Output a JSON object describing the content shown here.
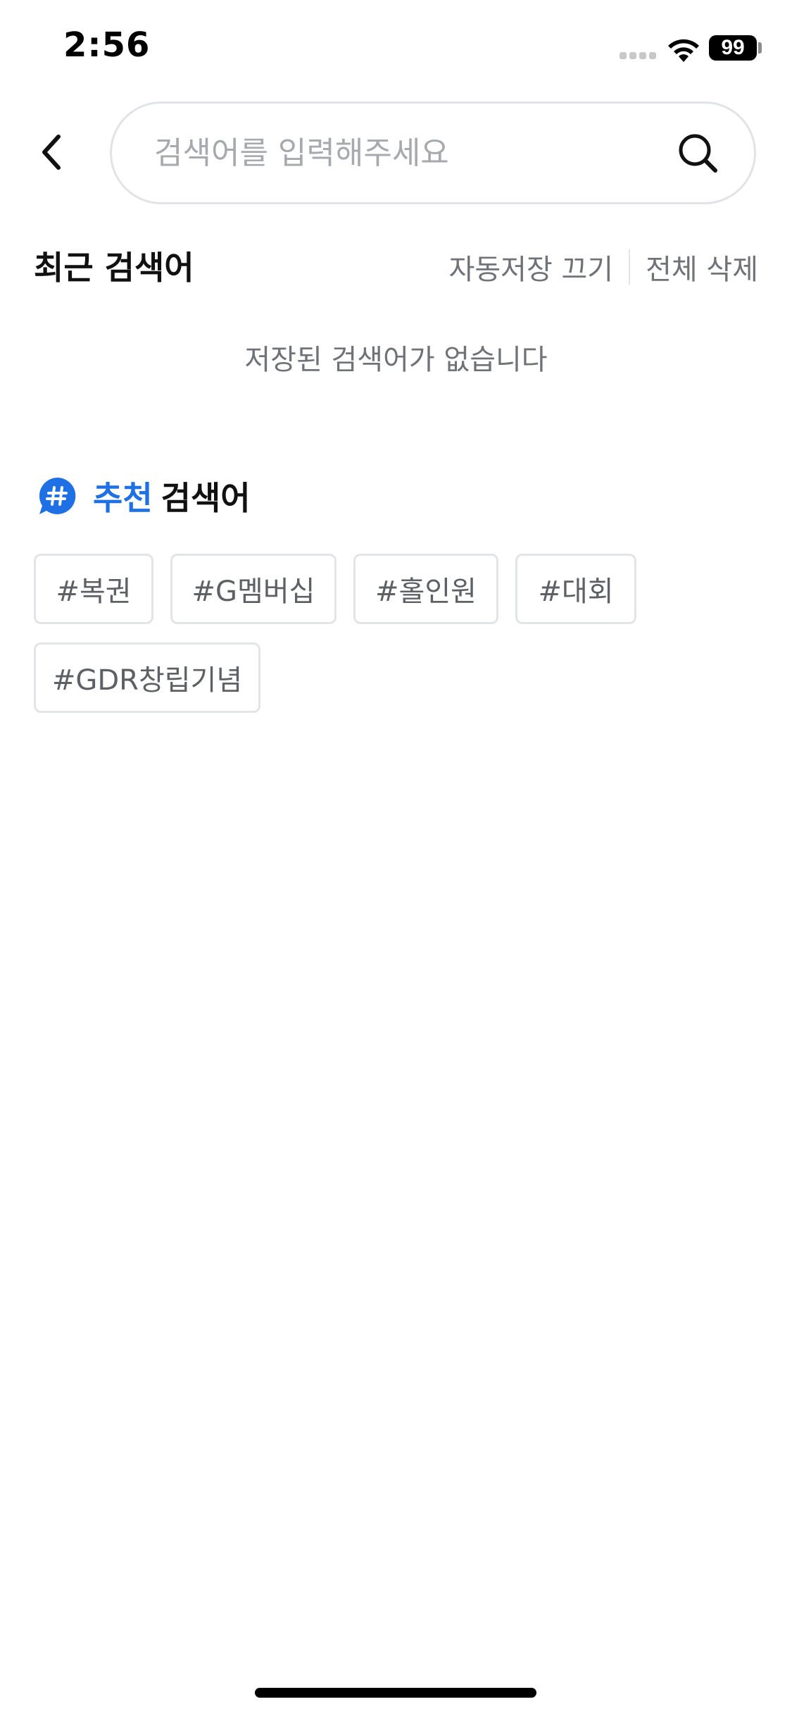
{
  "status_bar": {
    "time": "2:56",
    "battery": "99"
  },
  "search": {
    "placeholder": "검색어를 입력해주세요",
    "value": ""
  },
  "recent": {
    "title": "최근 검색어",
    "auto_save_label": "자동저장 끄기",
    "delete_all_label": "전체 삭제",
    "empty_message": "저장된 검색어가 없습니다"
  },
  "recommended": {
    "title_accent": "추천",
    "title_rest": "검색어",
    "accent_color": "#1f6fe5",
    "tags": [
      "#복권",
      "#G멤버십",
      "#홀인원",
      "#대회",
      "#GDR창립기념"
    ]
  },
  "icons": {
    "back": "chevron-left-icon",
    "search": "search-icon",
    "hashtag": "hashtag-chat-icon",
    "wifi": "wifi-icon"
  }
}
